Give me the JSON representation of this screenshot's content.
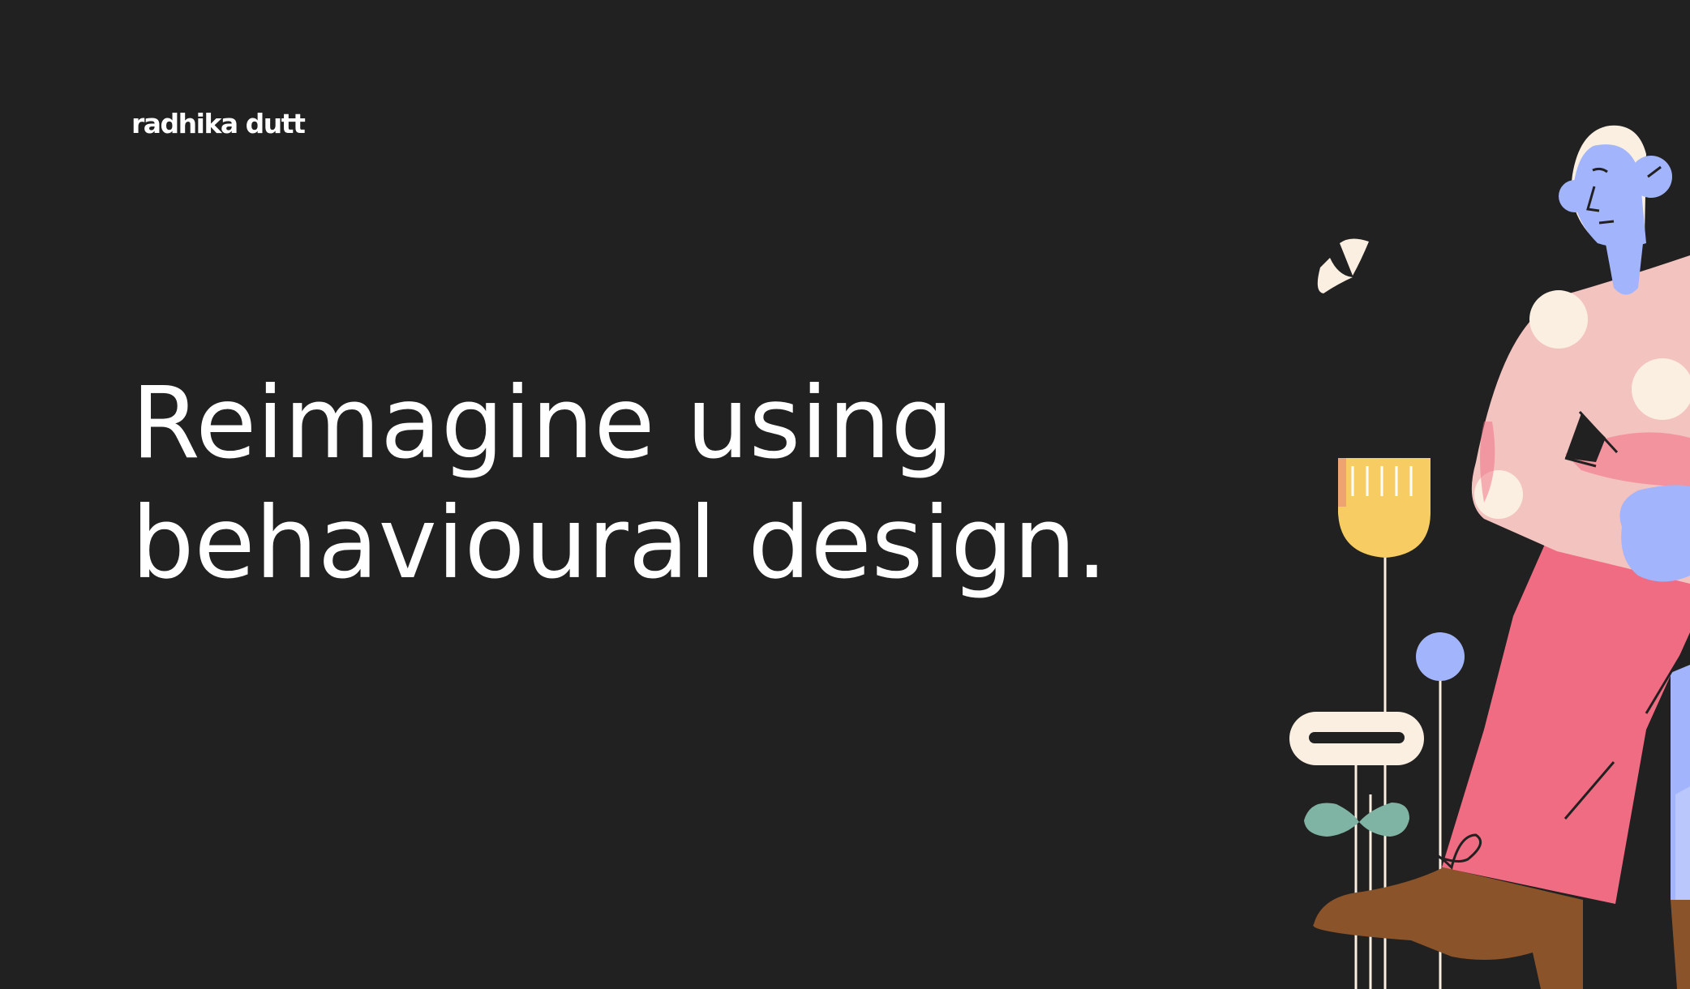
{
  "brand": {
    "name": "radhika dutt"
  },
  "hero": {
    "line1": "Reimagine using",
    "line2": "behavioural design."
  },
  "colors": {
    "background": "#212121",
    "text": "#ffffff",
    "cream": "#fbefe1",
    "blue": "#a2b4fb",
    "pink": "#f06c82",
    "blush": "#f3c3c0",
    "yellow": "#f7cd63",
    "green": "#7fb3a3",
    "brown": "#8a5329"
  },
  "illustration": {
    "subject": "person-with-flowers-illustration"
  }
}
